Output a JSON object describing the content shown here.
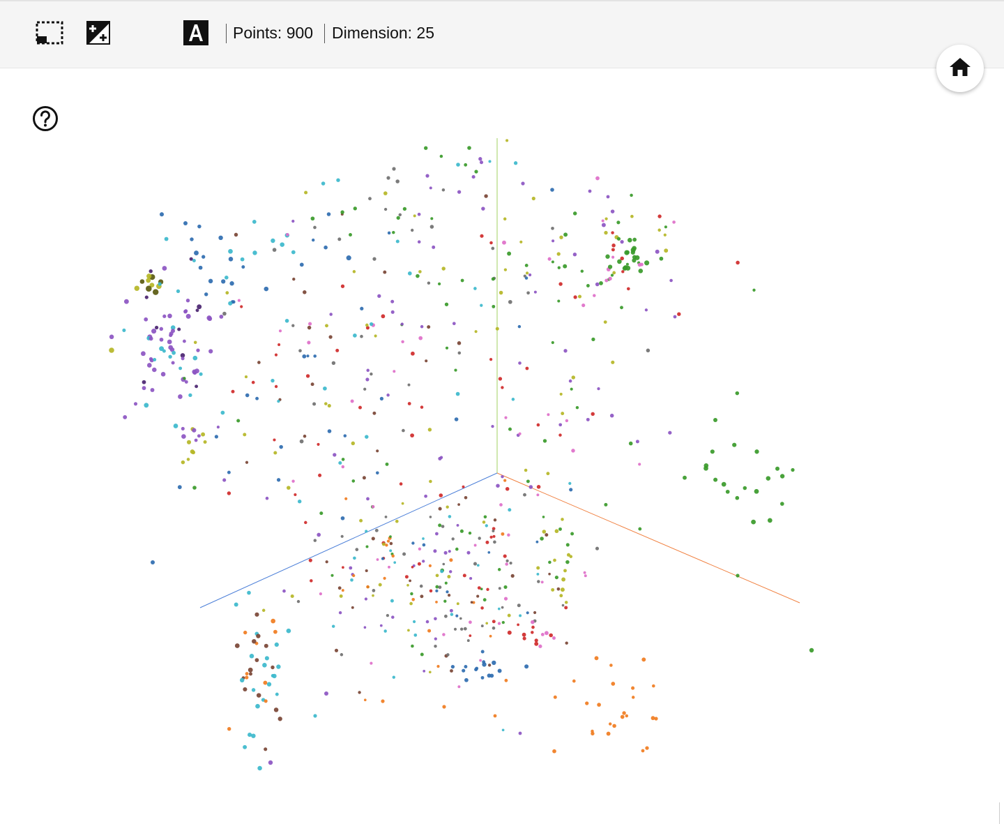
{
  "toolbar": {
    "tools": [
      {
        "name": "select-region-tool",
        "icon": "selection-box-icon"
      },
      {
        "name": "edit-labels-tool",
        "icon": "contrast-plus-icon"
      },
      {
        "name": "night-mode-tool",
        "icon": "moon-icon"
      },
      {
        "name": "label-toggle-tool",
        "icon": "letter-a-icon"
      }
    ],
    "points_text": "Points: 900",
    "dimension_text": "Dimension: 25"
  },
  "home_button": {
    "icon": "home-icon"
  },
  "help_button": {
    "icon": "help-icon"
  },
  "colors": {
    "x_axis": "#f08040",
    "y_axis": "#a0d060",
    "z_axis": "#4a7ed8",
    "classes": {
      "blue": "#2f6cb0",
      "orange": "#f07c20",
      "green": "#3a9a2a",
      "red": "#cf2a2a",
      "purple": "#8c55c2",
      "brown": "#7a4535",
      "pink": "#de6fc9",
      "gray": "#707070",
      "olive": "#b5b626",
      "cyan": "#3cb8cc",
      "darkpurple": "#4a2470",
      "darkolive": "#5a5a10"
    }
  },
  "chart_data": {
    "type": "scatter",
    "projection": "3d",
    "point_count": 900,
    "dimension": 25,
    "classes": [
      "blue",
      "orange",
      "green",
      "red",
      "purple",
      "brown",
      "pink",
      "gray",
      "olive",
      "cyan"
    ]
  }
}
